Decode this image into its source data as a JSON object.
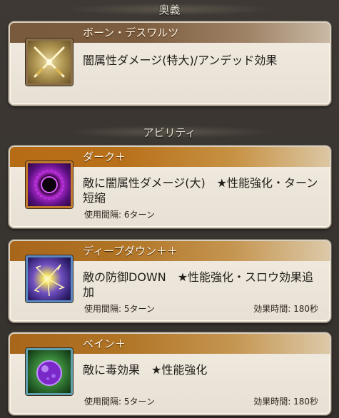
{
  "sections": {
    "ougi_label": "奥義",
    "ability_label": "アビリティ"
  },
  "ougi": {
    "name": "ボーン・デスワルツ",
    "description": "闇属性ダメージ(特大)/アンデッド効果",
    "icon": "crossed-swords-icon"
  },
  "abilities": [
    {
      "name": "ダーク＋",
      "description": "敵に闇属性ダメージ(大)　★性能強化・ターン短縮",
      "cooldown": "使用間隔: 6ターン",
      "duration": "",
      "icon": "dark-orb-icon"
    },
    {
      "name": "ディープダウン＋＋",
      "description": "敵の防御DOWN　★性能強化・スロウ効果追加",
      "cooldown": "使用間隔: 5ターン",
      "duration": "効果時間: 180秒",
      "icon": "lightning-burst-icon"
    },
    {
      "name": "ベイン＋",
      "description": "敵に毒効果　★性能強化",
      "cooldown": "使用間隔: 5ターン",
      "duration": "効果時間: 180秒",
      "icon": "poison-orb-icon"
    }
  ],
  "colors": {
    "background": "#3a3632",
    "card": "#ede6db",
    "ougi_title": "#7a5a3c",
    "ability_title": "#b66c14"
  }
}
